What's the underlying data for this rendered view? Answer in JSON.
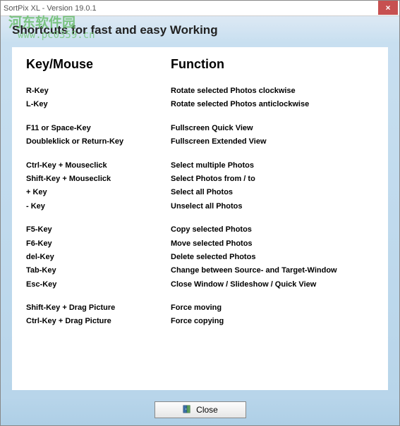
{
  "titlebar": {
    "title": "SortPix XL - Version 19.0.1",
    "close_x": "×"
  },
  "watermark": {
    "line1": "河东软件园",
    "line2": "www.pc0359.cn"
  },
  "banner": {
    "heading": "Shortcuts for fast and easy Working"
  },
  "columns": {
    "key_header": "Key/Mouse",
    "func_header": "Function"
  },
  "groups": [
    {
      "rows": [
        {
          "key": "R-Key",
          "func": "Rotate selected Photos clockwise"
        },
        {
          "key": "L-Key",
          "func": "Rotate selected Photos anticlockwise"
        }
      ]
    },
    {
      "rows": [
        {
          "key": "F11 or Space-Key",
          "func": "Fullscreen Quick View"
        },
        {
          "key": "Doubleklick or Return-Key",
          "func": "Fullscreen Extended View"
        }
      ]
    },
    {
      "rows": [
        {
          "key": "Ctrl-Key + Mouseclick",
          "func": "Select multiple Photos"
        },
        {
          "key": "Shift-Key + Mouseclick",
          "func": "Select Photos  from / to"
        },
        {
          "key": "+ Key",
          "func": "Select all Photos"
        },
        {
          "key": "- Key",
          "func": "Unselect all Photos"
        }
      ]
    },
    {
      "rows": [
        {
          "key": "F5-Key",
          "func": "Copy selected Photos"
        },
        {
          "key": "F6-Key",
          "func": "Move selected Photos"
        },
        {
          "key": "del-Key",
          "func": "Delete selected Photos"
        },
        {
          "key": "Tab-Key",
          "func": "Change between Source- and Target-Window"
        },
        {
          "key": "Esc-Key",
          "func": "Close Window / Slideshow / Quick View"
        }
      ]
    },
    {
      "rows": [
        {
          "key": "Shift-Key + Drag Picture",
          "func": "Force moving"
        },
        {
          "key": "Ctrl-Key + Drag Picture",
          "func": "Force copying"
        }
      ]
    }
  ],
  "footer": {
    "close_label": "Close"
  }
}
